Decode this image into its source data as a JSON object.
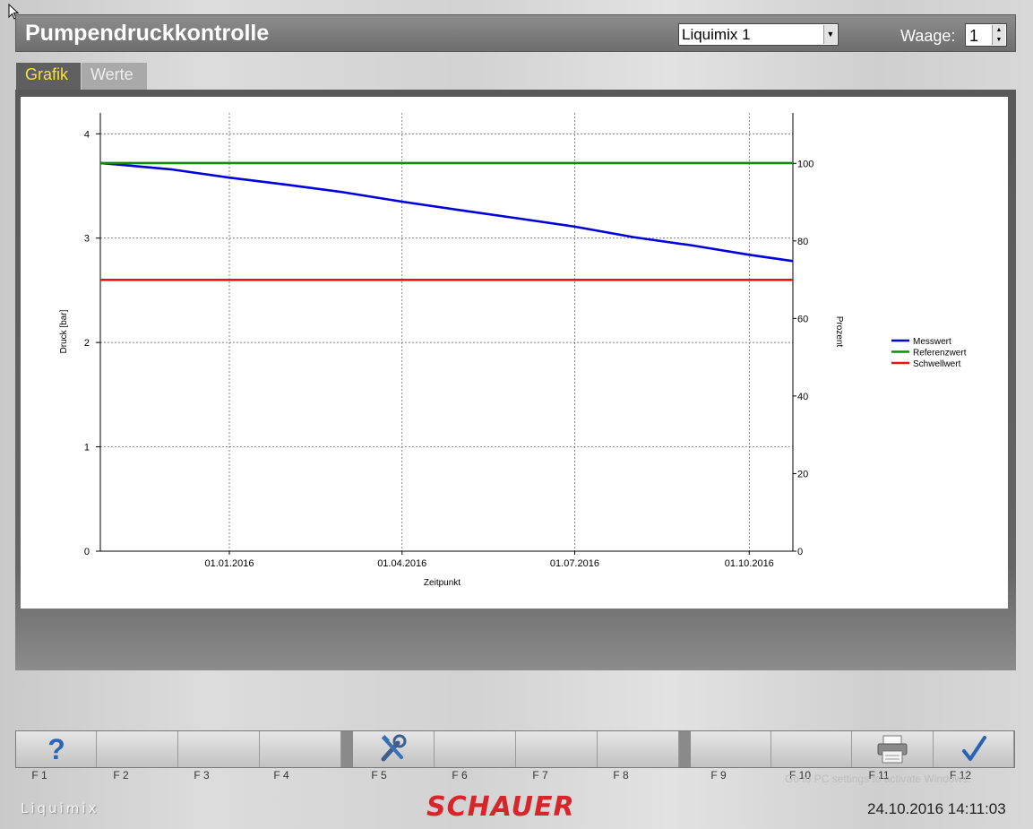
{
  "header": {
    "title": "Pumpendruckkontrolle",
    "device_select": "Liquimix 1",
    "waage_label": "Waage:",
    "waage_value": "1"
  },
  "tabs": [
    {
      "label": "Grafik",
      "active": true
    },
    {
      "label": "Werte",
      "active": false
    }
  ],
  "chart_data": {
    "type": "line",
    "xlabel": "Zeitpunkt",
    "ylabel": "Druck [bar]",
    "y2label": "Prozent",
    "x_ticks": [
      "01.01.2016",
      "01.04.2016",
      "01.07.2016",
      "01.10.2016"
    ],
    "x_range": [
      "2015-10-25",
      "2016-10-24"
    ],
    "ylim": [
      0,
      4.2
    ],
    "y_ticks": [
      0,
      1,
      2,
      3,
      4
    ],
    "y2lim": [
      0,
      113
    ],
    "y2_ticks": [
      0,
      20,
      40,
      60,
      80,
      100
    ],
    "grid": true,
    "legend_position": "right",
    "series": [
      {
        "name": "Messwert",
        "color": "#0000d8",
        "x": [
          "2015-10-25",
          "2015-12-01",
          "2016-01-01",
          "2016-02-01",
          "2016-03-01",
          "2016-04-01",
          "2016-05-01",
          "2016-06-01",
          "2016-07-01",
          "2016-08-01",
          "2016-09-01",
          "2016-10-01",
          "2016-10-24"
        ],
        "values": [
          3.72,
          3.66,
          3.58,
          3.51,
          3.44,
          3.35,
          3.27,
          3.19,
          3.11,
          3.01,
          2.93,
          2.84,
          2.78
        ]
      },
      {
        "name": "Referenzwert",
        "color": "#118a11",
        "x": [
          "2015-10-25",
          "2016-10-24"
        ],
        "values": [
          3.72,
          3.72
        ]
      },
      {
        "name": "Schwellwert",
        "color": "#ee1111",
        "x": [
          "2015-10-25",
          "2016-10-24"
        ],
        "values": [
          2.6,
          2.6
        ]
      }
    ]
  },
  "function_keys": [
    {
      "label": "F 1",
      "icon": "help-icon"
    },
    {
      "label": "F 2",
      "icon": ""
    },
    {
      "label": "F 3",
      "icon": ""
    },
    {
      "label": "F 4",
      "icon": ""
    },
    {
      "label": "F 5",
      "icon": "tools-icon"
    },
    {
      "label": "F 6",
      "icon": ""
    },
    {
      "label": "F 7",
      "icon": ""
    },
    {
      "label": "F 8",
      "icon": ""
    },
    {
      "label": "F 9",
      "icon": ""
    },
    {
      "label": "F 10",
      "icon": ""
    },
    {
      "label": "F 11",
      "icon": "printer-icon"
    },
    {
      "label": "F 12",
      "icon": "checkmark-icon"
    }
  ],
  "footer": {
    "brand_left": "Liquimix",
    "brand_logo": "SCHAUER",
    "datetime": "24.10.2016 14:11:03",
    "watermark": "Go to PC settings to activate Windows."
  }
}
